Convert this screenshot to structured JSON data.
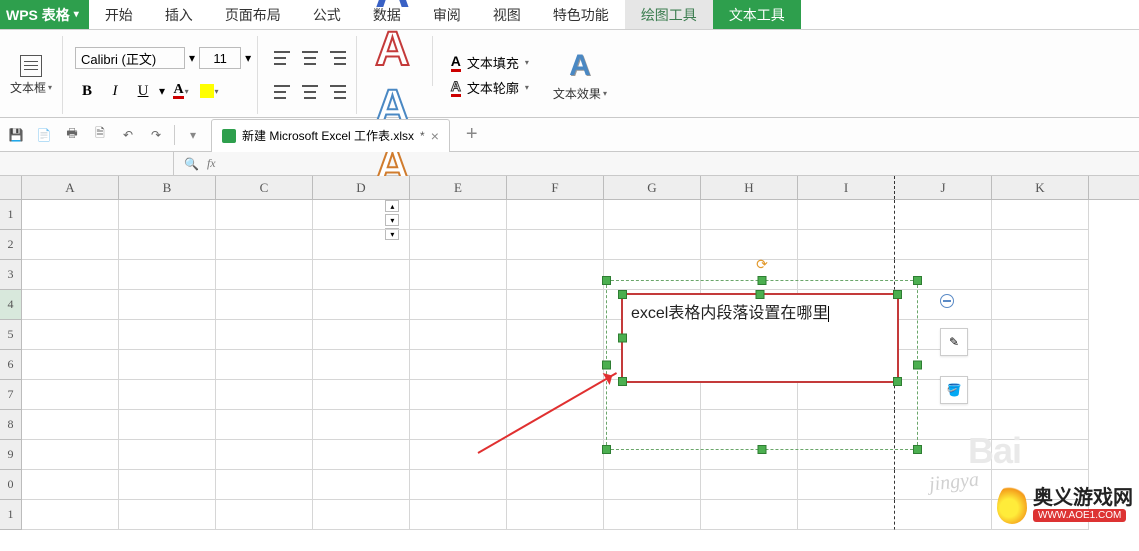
{
  "app": {
    "title": "WPS 表格"
  },
  "menu": {
    "items": [
      "开始",
      "插入",
      "页面布局",
      "公式",
      "数据",
      "审阅",
      "视图",
      "特色功能"
    ],
    "drawing_tools": "绘图工具",
    "text_tools": "文本工具"
  },
  "ribbon": {
    "textbox_label": "文本框",
    "font_name": "Calibri (正文)",
    "font_size": "11",
    "bold": "B",
    "italic": "I",
    "underline": "U",
    "font_color": "A",
    "style_A": "A",
    "text_fill": "文本填充",
    "text_outline": "文本轮廓",
    "text_effects": "文本效果"
  },
  "doc_tab": {
    "name": "新建 Microsoft Excel 工作表.xlsx",
    "modified": "*"
  },
  "formula_bar": {
    "fx": "fx",
    "name_box": ""
  },
  "columns": [
    "A",
    "B",
    "C",
    "D",
    "E",
    "F",
    "G",
    "H",
    "I",
    "J",
    "K"
  ],
  "rows": [
    "1",
    "2",
    "3",
    "4",
    "5",
    "6",
    "7",
    "8",
    "9",
    "0",
    "1"
  ],
  "row_active_index": 3,
  "textbox": {
    "content": "excel表格内段落设置在哪里"
  },
  "chart_data": null,
  "watermark": {
    "brand": "奥义游戏网",
    "site": "WWW.AOE1.COM",
    "bai": "Bai",
    "jy": "jingya"
  }
}
